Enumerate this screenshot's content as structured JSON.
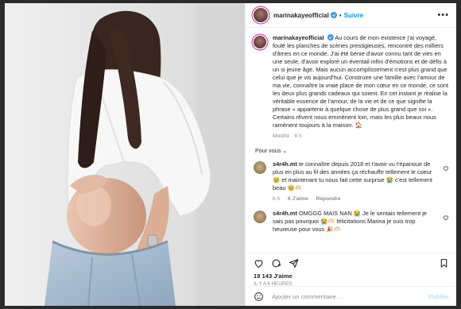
{
  "post": {
    "username": "marinakayeofficial",
    "follow_label": "Suivre",
    "more_glyph": "•••",
    "caption_username": "marinakayeofficial",
    "caption": "Au cours de mon existence j'ai voyagé, foulé les planches de scènes prestigieuses, rencontré des milliers d'âmes en ce monde. J'ai été bénie d'avoir connu tant de vies en une seule, d'avoir exploré un éventail infini d'émotions et de défis à un si jeune âge. Mais aucun accomplissement n'est plus grand que celui que je vis aujourd'hui. Construire une famille avec l'amour de ma vie, connaître la vraie place de mon cœur en ce monde, ce sont les deux plus grands cadeaux qui soient. En cet instant je réalise la véritable essence de l'amour, de la vie et de ce que signifie la phrase « appartenir à quelque chose de plus grand que soi ». Certains rêvent nous emmènent loin, mais les plus beaux nous ramènent toujours à la maison. 🏠",
    "edited_meta": "Modifié",
    "edited_dot": "·",
    "edited_age": "6 h",
    "for_you": "Pour vous",
    "for_you_arrow": "⌄"
  },
  "comments": [
    {
      "username": "s4r4h.mt",
      "text": "te connaître depuis 2018 et t'avoir vu t'épanouir de plus en plus au fil des années ça réchauffe tellement le coeur 🥹 et maintenant tu nous fait cette surprise 😭 c'est tellement beau 🥹🫶🏻",
      "age": "6 h",
      "likes": "6 J'aime",
      "reply": "Répondre"
    },
    {
      "username": "s4r4h.mt",
      "text": "OMGGG MAIS NAN 😭 Je le sentais tellement je sais pas pourquoi 😭🫶🏻 félicitations Marina je suis trop heureuse pour vous 🎉🫶🏻",
      "age": "",
      "likes": "",
      "reply": ""
    }
  ],
  "footer": {
    "likes": "19 143 J'aime",
    "time": "IL Y A 6 HEURES",
    "comment_placeholder": "Ajouter un commentaire…",
    "publish": "Publier"
  },
  "colors": {
    "accent": "#0095f6",
    "verified": "#3897f0",
    "muted": "#8e8e8e",
    "publish_disabled": "#b2dffc"
  },
  "icons": [
    "verified-badge-icon",
    "more-options-icon",
    "heart-icon",
    "comment-icon",
    "share-icon",
    "bookmark-icon",
    "emoji-icon"
  ]
}
